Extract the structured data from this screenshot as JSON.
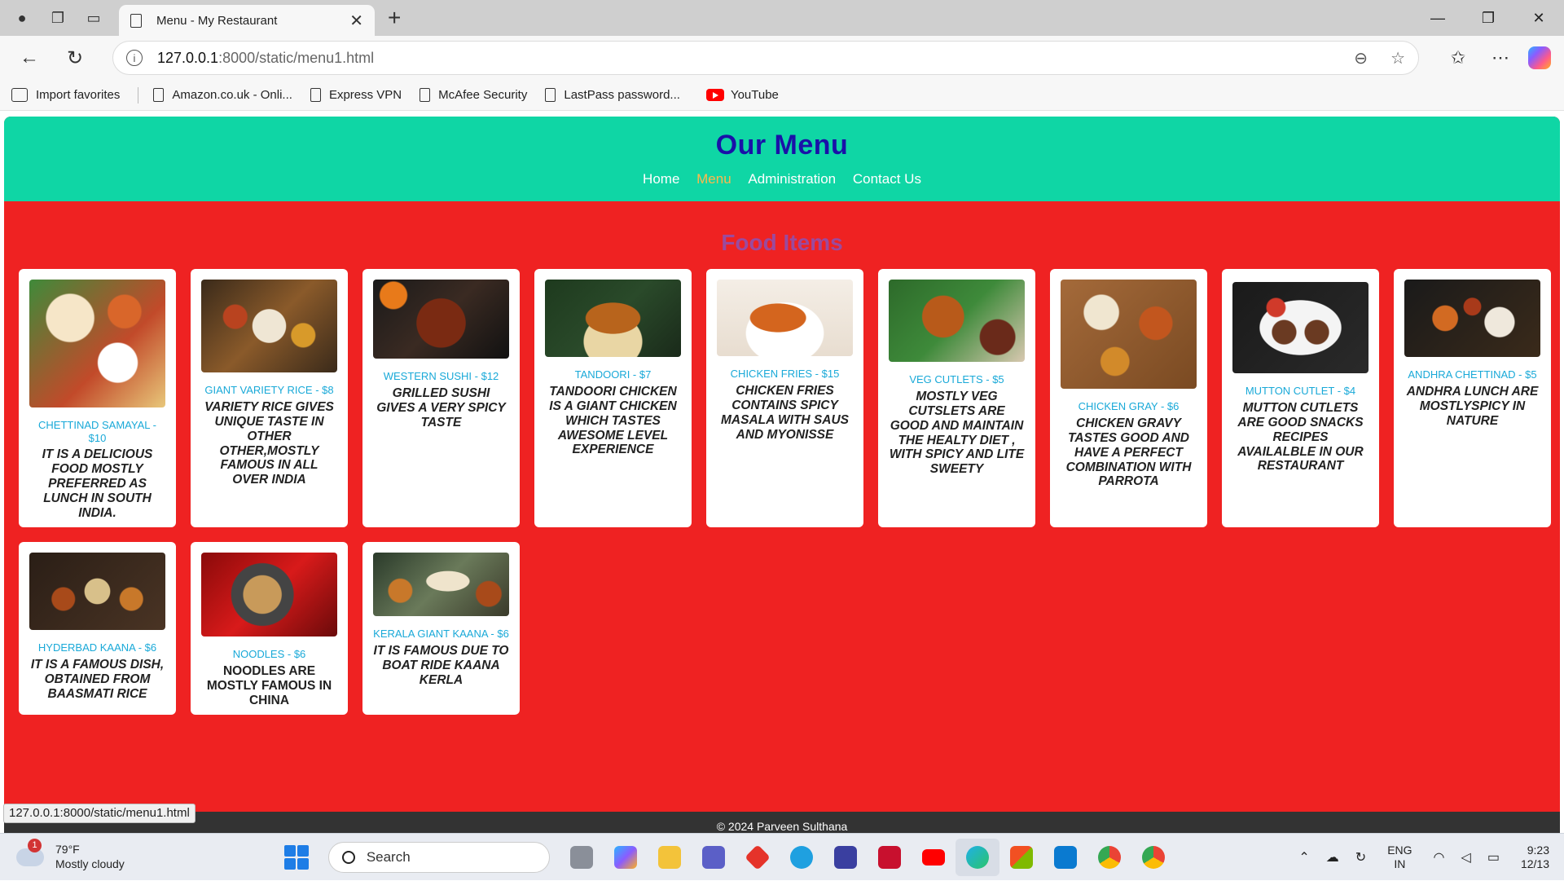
{
  "browser": {
    "tab_title": "Menu - My Restaurant",
    "url_host": "127.0.0.1",
    "url_path": ":8000/static/menu1.html",
    "favorites": [
      {
        "label": "Import favorites"
      },
      {
        "label": "Amazon.co.uk - Onli..."
      },
      {
        "label": "Express VPN"
      },
      {
        "label": "McAfee Security"
      },
      {
        "label": "LastPass password..."
      },
      {
        "label": "YouTube"
      }
    ],
    "status_url": "127.0.0.1:8000/static/menu1.html"
  },
  "site": {
    "title": "Our Menu",
    "nav": [
      "Home",
      "Menu",
      "Administration",
      "Contact Us"
    ],
    "active_nav": "Menu",
    "section_title": "Food Items",
    "footer": "© 2024 Parveen Sulthana",
    "colors": {
      "header_bg": "#0fd6a5",
      "page_bg": "#ef2222",
      "title": "#1a11a8",
      "item_name": "#19a9d8"
    }
  },
  "items": [
    {
      "name": "CHETTINAD SAMAYAL - $10",
      "desc": "IT IS A DELICIOUS FOOD MOSTLY PREFERRED AS LUNCH IN SOUTH INDIA."
    },
    {
      "name": "GIANT VARIETY RICE - $8",
      "desc": "VARIETY RICE GIVES UNIQUE TASTE IN OTHER OTHER,MOSTLY FAMOUS IN ALL OVER INDIA"
    },
    {
      "name": "WESTERN SUSHI - $12",
      "desc": "GRILLED SUSHI GIVES A VERY SPICY TASTE"
    },
    {
      "name": "TANDOORI - $7",
      "desc": "TANDOORI CHICKEN IS A GIANT CHICKEN WHICH TASTES AWESOME LEVEL EXPERIENCE"
    },
    {
      "name": "CHICKEN FRIES - $15",
      "desc": "CHICKEN FRIES CONTAINS SPICY MASALA WITH SAUS AND MYONISSE"
    },
    {
      "name": "VEG CUTLETS - $5",
      "desc": "MOSTLY VEG CUTSLETS ARE GOOD AND MAINTAIN THE HEALTY DIET , WITH SPICY AND LITE SWEETY"
    },
    {
      "name": "CHICKEN GRAY - $6",
      "desc": "CHICKEN GRAVY TASTES GOOD AND HAVE A PERFECT COMBINATION WITH PARROTA"
    },
    {
      "name": "MUTTON CUTLET - $4",
      "desc": "MUTTON CUTLETS ARE GOOD SNACKS RECIPES AVAILALBLE IN OUR RESTAURANT"
    },
    {
      "name": "ANDHRA CHETTINAD - $5",
      "desc": "ANDHRA LUNCH ARE MOSTLYSPICY IN NATURE"
    },
    {
      "name": "HYDERBAD KAANA - $6",
      "desc": "IT IS A FAMOUS DISH, OBTAINED FROM BAASMATI RICE"
    },
    {
      "name": "NOODLES - $6",
      "desc": "NOODLES ARE MOSTLY FAMOUS IN CHINA"
    },
    {
      "name": "KERALA GIANT KAANA - $6",
      "desc": "IT IS FAMOUS DUE TO BOAT RIDE KAANA KERLA"
    }
  ],
  "taskbar": {
    "temperature": "79°F",
    "weather": "Mostly cloudy",
    "weather_badge": "1",
    "search_placeholder": "Search",
    "lang1": "ENG",
    "lang2": "IN",
    "time": "9:23",
    "date": "12/13"
  }
}
